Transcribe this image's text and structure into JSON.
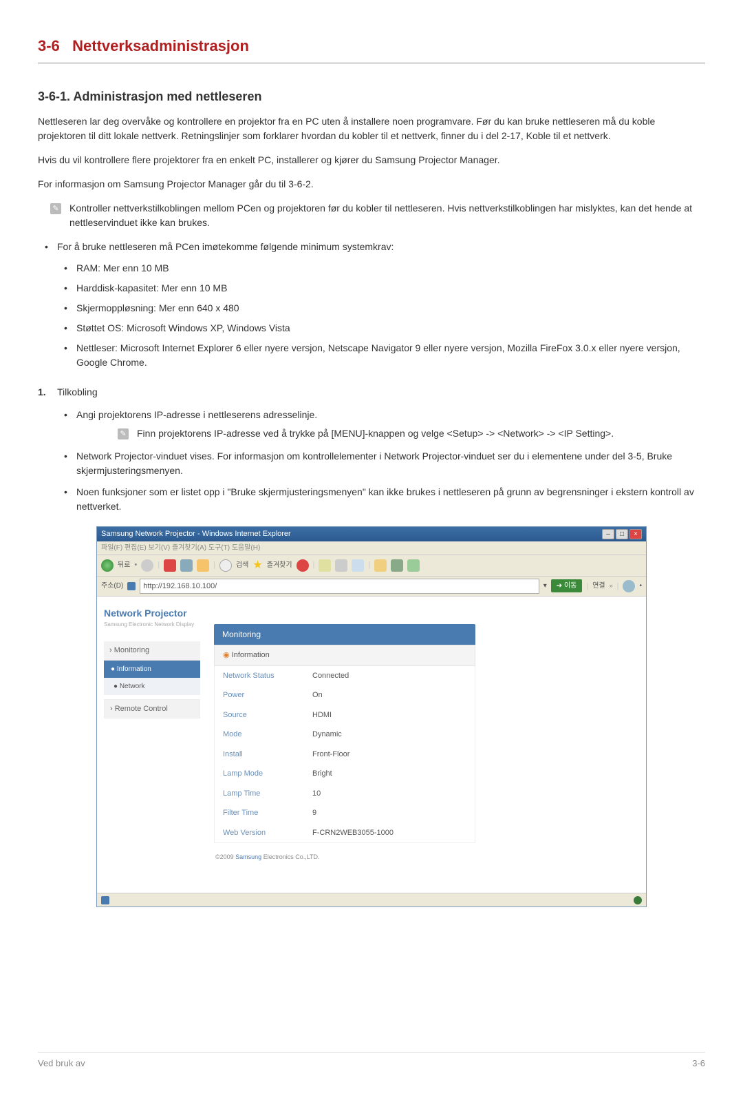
{
  "heading": {
    "number": "3-6",
    "title": "Nettverksadministrasjon"
  },
  "sub1": {
    "number": "3-6-1.",
    "title": "Administrasjon med nettleseren"
  },
  "para1": "Nettleseren lar deg overvåke og kontrollere en projektor fra en PC uten å installere noen programvare. Før du kan bruke nettleseren må du koble projektoren til ditt lokale nettverk. Retningslinjer som forklarer hvordan du kobler til et nettverk, finner du i del 2-17, Koble til et nettverk.",
  "para2": "Hvis du vil kontrollere flere projektorer fra en enkelt PC, installerer og kjører du Samsung Projector Manager.",
  "para3": "For informasjon om Samsung Projector Manager går du til 3-6-2.",
  "note1": "Kontroller nettverkstilkoblingen mellom PCen og projektoren før du kobler til nettleseren. Hvis nettverkstilkoblingen har mislyktes, kan det hende at nettleservinduet ikke kan brukes.",
  "req_intro": "For å bruke nettleseren må PCen imøtekomme følgende minimum systemkrav:",
  "reqs": [
    "RAM: Mer enn 10 MB",
    "Harddisk-kapasitet: Mer enn 10 MB",
    "Skjermoppløsning: Mer enn 640 x 480",
    "Støttet OS: Microsoft Windows XP, Windows Vista",
    "Nettleser: Microsoft Internet Explorer 6 eller nyere versjon, Netscape Navigator 9 eller nyere versjon, Mozilla FireFox 3.0.x eller nyere versjon, Google Chrome."
  ],
  "step1": {
    "num": "1.",
    "label": "Tilkobling"
  },
  "step1_a": "Angi projektorens IP-adresse i nettleserens adresselinje.",
  "step1_note": "Finn projektorens IP-adresse ved å trykke på [MENU]-knappen og velge <Setup> -> <Network> -> <IP Setting>.",
  "step1_b": "Network Projector-vinduet vises. For informasjon om kontrollelementer i Network Projector-vinduet ser du i elementene under del 3-5, Bruke skjermjusteringsmenyen.",
  "step1_c": "Noen funksjoner som er listet opp i \"Bruke skjermjusteringsmenyen\" kan ikke brukes i nettleseren på grunn av begrensninger i ekstern kontroll av nettverket.",
  "ie": {
    "title": "Samsung Network Projector - Windows Internet Explorer",
    "menubar": "파일(F)  편집(E)  보기(V)  즐겨찾기(A)  도구(T)  도움말(H)",
    "back": "뒤로",
    "search": "검색",
    "fav": "즐겨찾기",
    "addr_label": "주소(D)",
    "url": "http://192.168.10.100/",
    "go": "이동",
    "link": "연결",
    "np_title": "Network Projector",
    "np_sub": "Samsung Electronic Network Display",
    "menu_monitoring": "Monitoring",
    "menu_info": "Information",
    "menu_network": "Network",
    "menu_remote": "Remote Control",
    "tab": "Monitoring",
    "panel": "Information",
    "rows": [
      {
        "l": "Network Status",
        "v": "Connected"
      },
      {
        "l": "Power",
        "v": "On"
      },
      {
        "l": "Source",
        "v": "HDMI"
      },
      {
        "l": "Mode",
        "v": "Dynamic"
      },
      {
        "l": "Install",
        "v": "Front-Floor"
      },
      {
        "l": "Lamp Mode",
        "v": "Bright"
      },
      {
        "l": "Lamp Time",
        "v": "10"
      },
      {
        "l": "Filter Time",
        "v": "9"
      },
      {
        "l": "Web Version",
        "v": "F-CRN2WEB3055-1000"
      }
    ],
    "copyright_pre": "©2009 ",
    "copyright_link": "Samsung ",
    "copyright_post": "Electronics Co.,LTD."
  },
  "footer": {
    "left": "Ved bruk av",
    "right": "3-6"
  }
}
